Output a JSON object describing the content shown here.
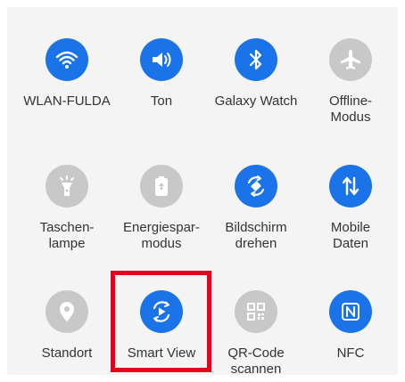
{
  "colors": {
    "active": "#1a73e8",
    "inactive": "#c8c8c8",
    "highlight": "#e8001c"
  },
  "tiles": [
    {
      "label": "WLAN-FULDA",
      "icon": "wifi-icon",
      "active": true
    },
    {
      "label": "Ton",
      "icon": "volume-icon",
      "active": true
    },
    {
      "label": "Galaxy Watch",
      "icon": "bluetooth-icon",
      "active": true
    },
    {
      "label": "Offline-\nModus",
      "icon": "airplane-icon",
      "active": false
    },
    {
      "label": "Taschen-\nlampe",
      "icon": "flashlight-icon",
      "active": false
    },
    {
      "label": "Energiespar-\nmodus",
      "icon": "battery-saver-icon",
      "active": false
    },
    {
      "label": "Bildschirm\ndrehen",
      "icon": "auto-rotate-icon",
      "active": true
    },
    {
      "label": "Mobile\nDaten",
      "icon": "mobile-data-icon",
      "active": true
    },
    {
      "label": "Standort",
      "icon": "location-icon",
      "active": false
    },
    {
      "label": "Smart View",
      "icon": "smart-view-icon",
      "active": true
    },
    {
      "label": "QR-Code\nscannen",
      "icon": "qr-code-icon",
      "active": false
    },
    {
      "label": "NFC",
      "icon": "nfc-icon",
      "active": true
    }
  ]
}
